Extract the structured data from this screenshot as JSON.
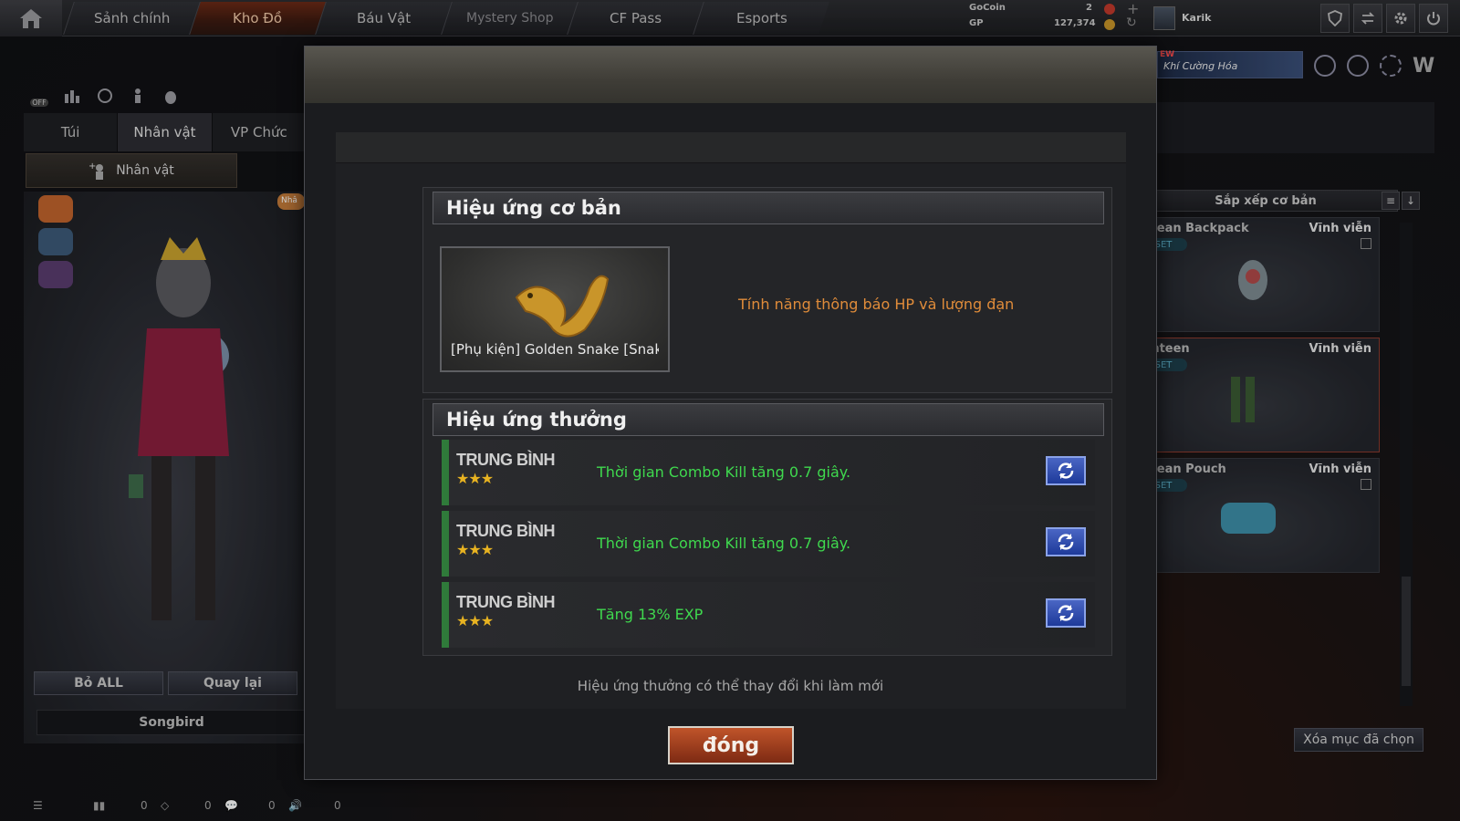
{
  "topbar": {
    "tabs": [
      "Sảnh chính",
      "Kho Đồ",
      "Báu Vật",
      "Mystery Shop",
      "CF Pass",
      "Esports"
    ],
    "gocoin_label": "GoCoin",
    "gocoin_value": "2",
    "gp_label": "GP",
    "gp_value": "127,374",
    "username": "Karik",
    "promo_tag": "Khí Cường Hóa",
    "promo_new": "EW"
  },
  "left_panel": {
    "sound_toggle": "OFF",
    "tabs": [
      "Túi",
      "Nhân vật",
      "VP Chức"
    ],
    "subtab": "Nhân vật",
    "side_tag": "Nhâ",
    "btn_remove_all": "Bỏ ALL",
    "btn_back": "Quay lại",
    "character_name": "Songbird"
  },
  "right_panel": {
    "sort_label": "Sắp xếp cơ bản",
    "items": [
      {
        "name": "Ocean Backpack",
        "duration": "Vĩnh viễn",
        "tag": "SET"
      },
      {
        "name": "Canteen",
        "duration": "Vĩnh viễn",
        "tag": "SET"
      },
      {
        "name": "Ocean Pouch",
        "duration": "Vĩnh viễn",
        "tag": "SET"
      }
    ],
    "clear_selected": "Xóa mục đã chọn"
  },
  "status": {
    "v1": "0",
    "v2": "0",
    "v3": "0",
    "v4": "0"
  },
  "modal": {
    "basic_title": "Hiệu ứng cơ bản",
    "item_name": "[Phụ kiện] Golden Snake [Snake]",
    "basic_effect": "Tính năng thông báo HP và lượng đạn",
    "bonus_title": "Hiệu ứng thưởng",
    "effects": [
      {
        "grade": "TRUNG BÌNH",
        "stars": "★★★",
        "text": "Thời gian Combo Kill tăng 0.7 giây."
      },
      {
        "grade": "TRUNG BÌNH",
        "stars": "★★★",
        "text": "Thời gian Combo Kill tăng 0.7 giây."
      },
      {
        "grade": "TRUNG BÌNH",
        "stars": "★★★",
        "text": "Tăng 13% EXP"
      }
    ],
    "note": "Hiệu ứng thưởng có thể thay đổi khi làm mới",
    "close_label": "đóng"
  },
  "colors": {
    "basic_effect_text": "#e08c3a",
    "bonus_effect_text": "#3fd94e",
    "stars": "#e8b321",
    "close_button": "#b24a22"
  }
}
